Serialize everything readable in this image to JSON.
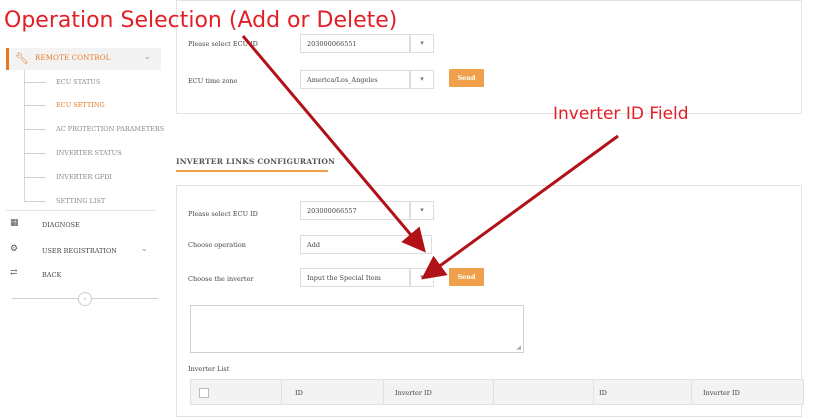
{
  "annotations": {
    "operation_selection": "Operation Selection (Add or Delete)",
    "inverter_id_field": "Inverter ID Field"
  },
  "sidebar": {
    "remote_control": {
      "label": "REMOTE CONTROL",
      "icon": "wrench-icon"
    },
    "sub_items": [
      {
        "label": "ECU STATUS",
        "active": false
      },
      {
        "label": "ECU SETTING",
        "active": true
      },
      {
        "label": "AC PROTECTION PARAMETERS",
        "active": false
      },
      {
        "label": "INVERTER STATUS",
        "active": false
      },
      {
        "label": "INVERTER GFDI",
        "active": false
      },
      {
        "label": "SETTING LIST",
        "active": false
      }
    ],
    "diagnose": {
      "label": "DIAGNOSE",
      "icon": "calendar-icon"
    },
    "user_registration": {
      "label": "USER REGISTRATION",
      "icon": "gears-icon"
    },
    "back": {
      "label": "BACK",
      "icon": "exchange-icon"
    }
  },
  "top_panel": {
    "ecu_id_label": "Please select ECU ID",
    "ecu_id_value": "203000066551",
    "timezone_label": "ECU time zone",
    "timezone_value": "America/Los_Angeles",
    "send_label": "Send"
  },
  "section": {
    "title": "INVERTER LINKS CONFIGURATION"
  },
  "inverter_panel": {
    "ecu_id_label": "Please select ECU ID",
    "ecu_id_value": "203000066557",
    "operation_label": "Choose operation",
    "operation_value": "Add",
    "inverter_label": "Choose the inverter",
    "inverter_value": "Input the Special Item",
    "send_label": "Send",
    "inverter_list_label": "Inverter List",
    "table_headers": [
      "ID",
      "Inverter ID",
      "ID",
      "Inverter ID"
    ]
  },
  "colors": {
    "accent": "#f0a04b",
    "annotation": "#e21f26",
    "arrow": "#b11218"
  }
}
